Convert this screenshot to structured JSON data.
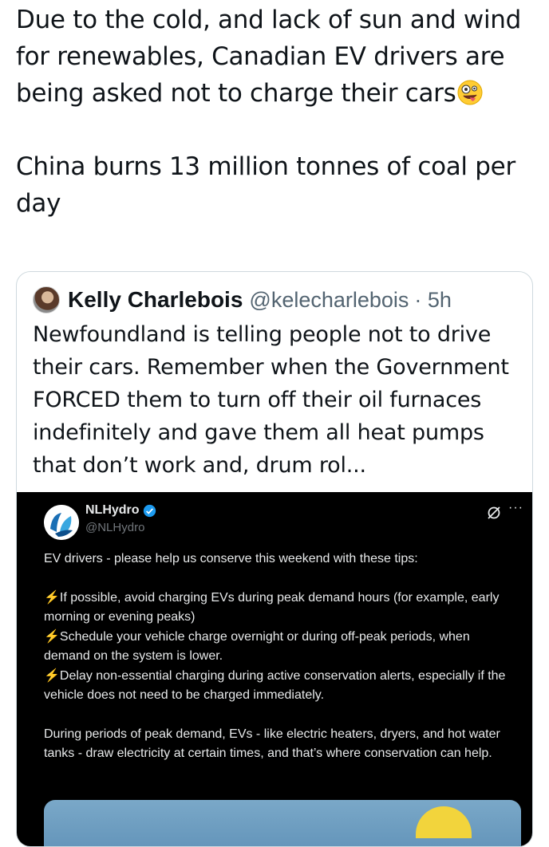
{
  "post": {
    "paragraph_1": "Due to the cold, and lack of sun and wind for renewables, Canadian EV drivers are being asked not to charge their cars",
    "emoji": "zany-face-emoji",
    "paragraph_2": "China burns 13 million tonnes of coal per day"
  },
  "quote": {
    "name": "Kelly Charlebois",
    "handle": "@kelecharlebois",
    "time": "· 5h",
    "text": "Newfoundland is telling people not to drive their cars. Remember when the Government FORCED them to turn off their oil furnaces indefinitely and gave them all heat pumps that don’t work and, drum rol..."
  },
  "embed": {
    "name": "NLHydro",
    "handle": "@NLHydro",
    "intro": "EV drivers - please help us conserve this weekend with these tips:",
    "tips": [
      "If possible, avoid charging EVs during peak demand hours (for example, early morning or evening peaks)",
      "Schedule your vehicle charge overnight or during off-peak periods, when demand on the system is lower.",
      "Delay non-essential charging during active conservation alerts, especially if the vehicle does not need to be charged immediately."
    ],
    "closing": "During periods of peak demand, EVs - like electric heaters, dryers, and hot water tanks - draw electricity at certain times, and that’s where conservation can help.",
    "more_icon": "···",
    "bolt_icon": "⚡"
  },
  "colors": {
    "text": "#0f1419",
    "secondary": "#536471",
    "embed_bg": "#000000",
    "bolt": "#f4a51c",
    "verified": "#1d9bf0"
  }
}
